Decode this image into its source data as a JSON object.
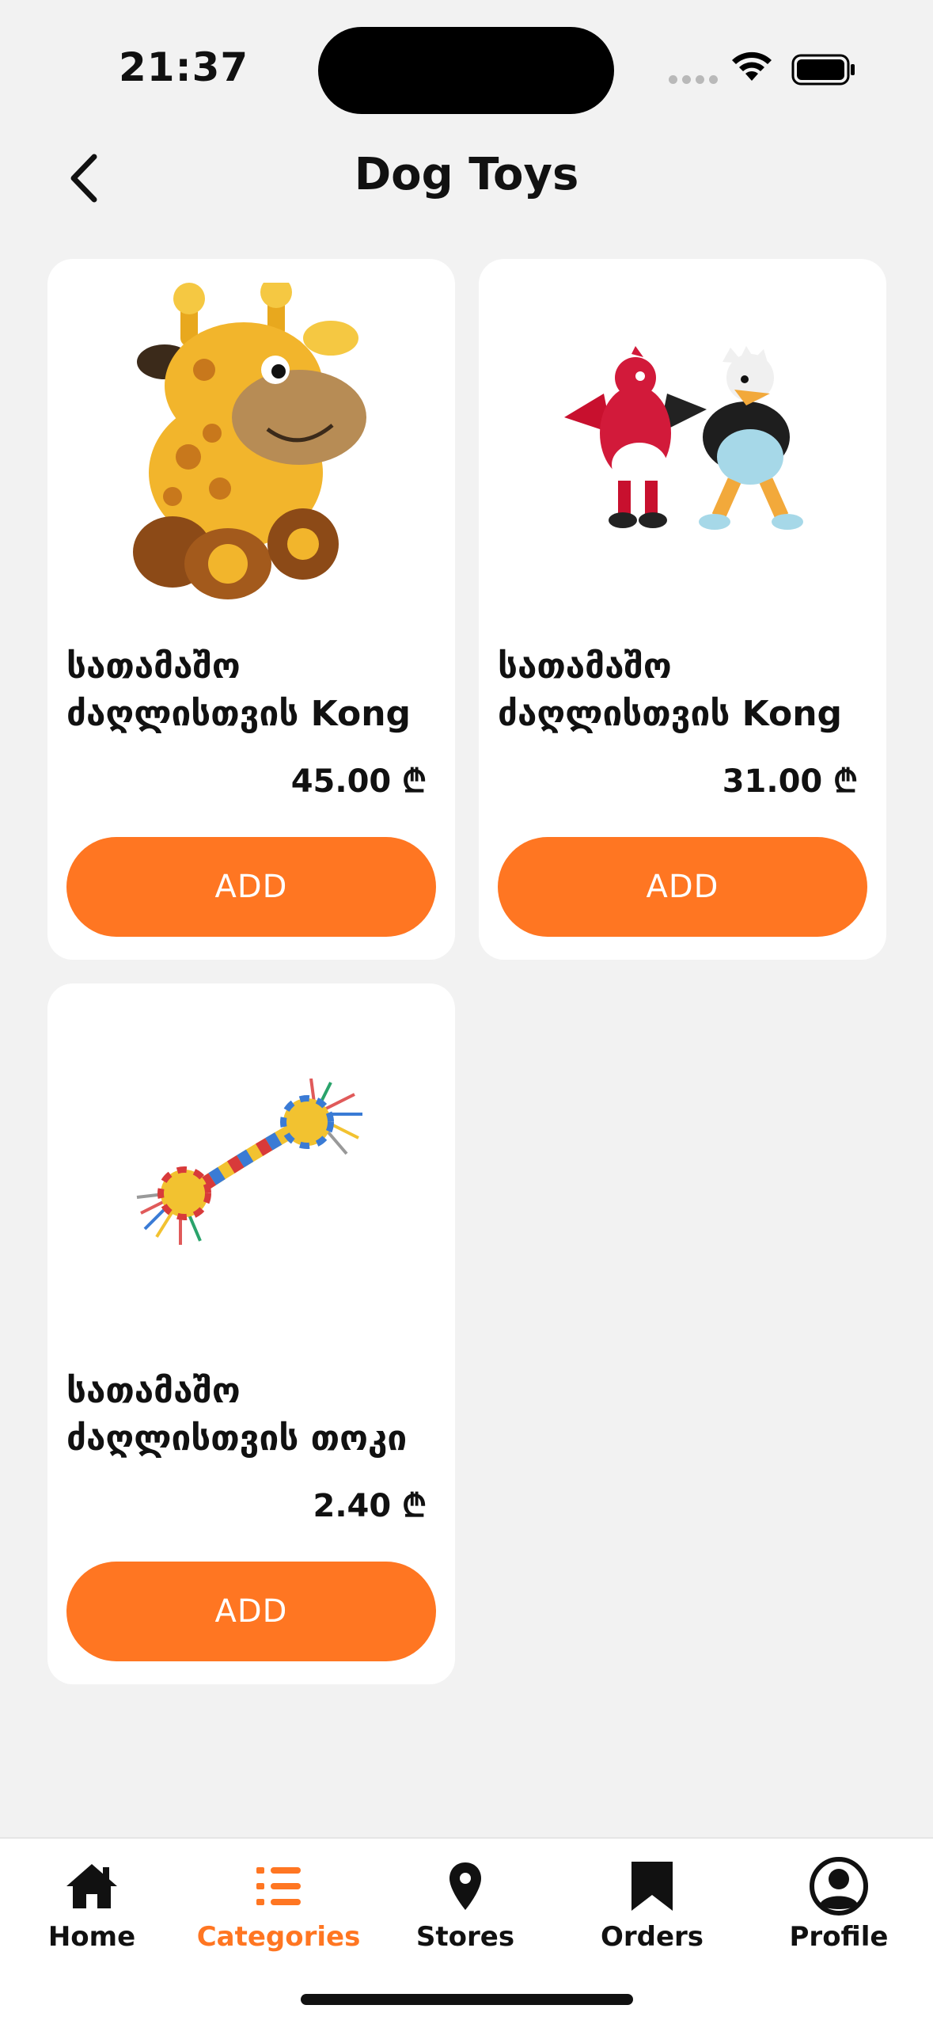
{
  "status_bar": {
    "time": "21:37"
  },
  "header": {
    "title": "Dog Toys",
    "back_icon": "chevron-left-icon"
  },
  "products": [
    {
      "name": "სათამაშო\nძაღლისთვის Kong",
      "price": "45.00 ₾",
      "button": "ADD",
      "image": "giraffe-toy"
    },
    {
      "name": "სათამაშო\nძაღლისთვის Kong",
      "price": "31.00 ₾",
      "button": "ADD",
      "image": "bird-plush-toys"
    },
    {
      "name": "სათამაშო\nძაღლისთვის თოკი",
      "price": "2.40 ₾",
      "button": "ADD",
      "image": "rope-toy"
    }
  ],
  "nav": {
    "items": [
      {
        "label": "Home",
        "icon": "home-icon"
      },
      {
        "label": "Categories",
        "icon": "list-icon",
        "active": true
      },
      {
        "label": "Stores",
        "icon": "location-pin-icon"
      },
      {
        "label": "Orders",
        "icon": "bookmark-icon"
      },
      {
        "label": "Profile",
        "icon": "user-circle-icon"
      }
    ]
  },
  "colors": {
    "accent": "#ff7622",
    "background": "#f2f2f2",
    "card": "#ffffff"
  }
}
